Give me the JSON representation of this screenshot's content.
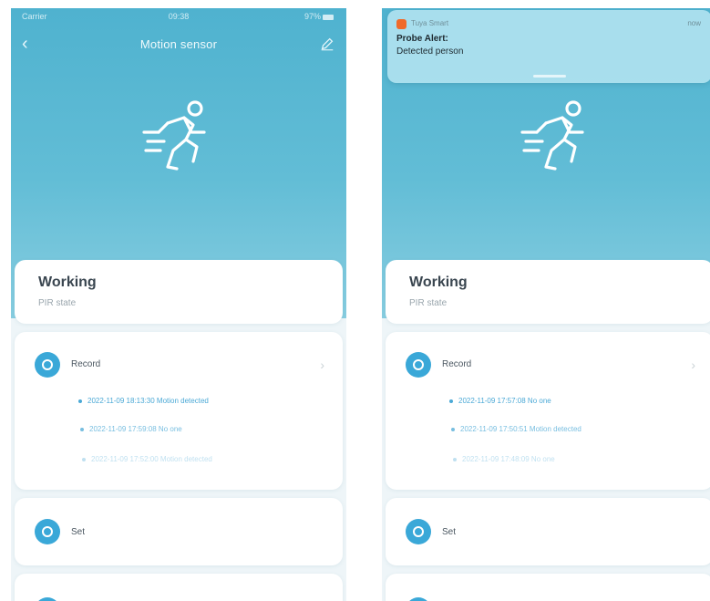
{
  "statusbar": {
    "left": "Carrier",
    "time": "09:38",
    "right": "97%"
  },
  "left_screen": {
    "nav_title": "Motion sensor",
    "status_title": "Working",
    "status_sub": "PIR state",
    "record_label": "Record",
    "record_entries": [
      "2022-11-09 18:13:30 Motion detected",
      "2022-11-09 17:59:08 No one",
      "2022-11-09 17:52:00 Motion detected"
    ],
    "set_label": "Set"
  },
  "right_screen": {
    "notification": {
      "app_name": "Tuya Smart",
      "time": "now",
      "title": "Probe Alert:",
      "body": "Detected person"
    },
    "status_title": "Working",
    "status_sub": "PIR state",
    "record_label": "Record",
    "record_entries": [
      "2022-11-09 17:57:08 No one",
      "2022-11-09 17:50:51 Motion detected",
      "2022-11-09 17:48:09 No one"
    ],
    "set_label": "Set"
  },
  "colors": {
    "hero_top": "#4fb2cf",
    "accent_icon": "#3aa8d8",
    "record_text": "#4ba9d6",
    "app_icon": "#f06a2a"
  },
  "icons": {
    "back": "chevron-left-icon",
    "edit": "pencil-icon",
    "hero": "running-person-icon",
    "record": "record-icon",
    "set": "gear-icon",
    "chevron": "chevron-right-icon"
  }
}
